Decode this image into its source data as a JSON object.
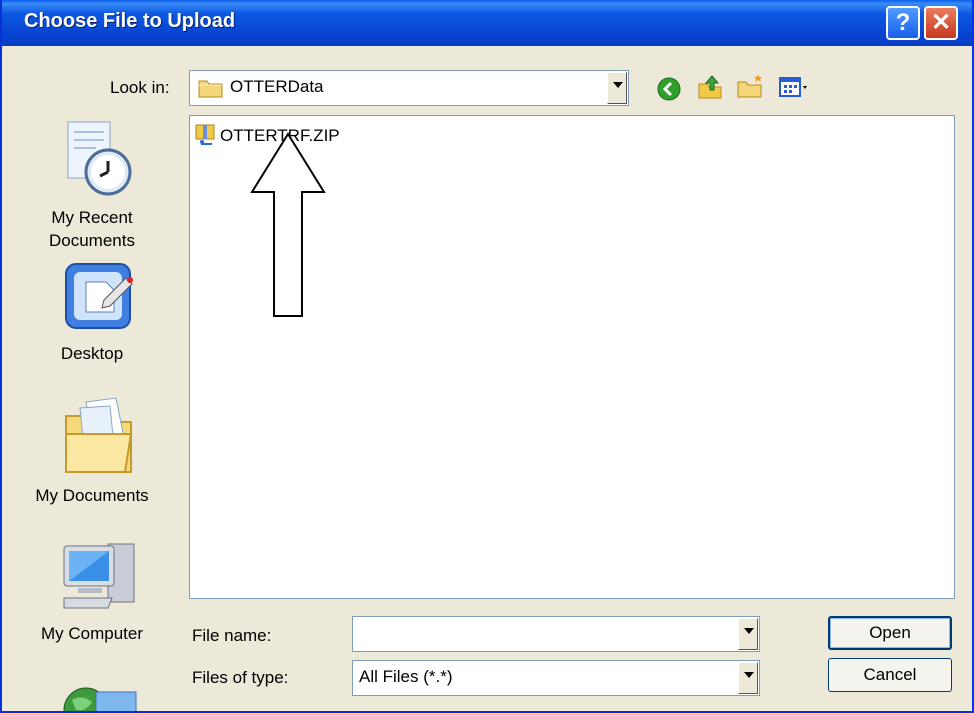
{
  "window": {
    "title": "Choose File to Upload",
    "help_glyph": "?",
    "close_glyph": "✕"
  },
  "toolbar": {
    "look_in_label": "Look in:",
    "look_in_value": "OTTERData",
    "icons": [
      "back-icon",
      "up-folder-icon",
      "new-folder-icon",
      "view-menu-icon"
    ]
  },
  "places": [
    {
      "label_lines": [
        "My Recent",
        "Documents"
      ],
      "icon": "recent-documents-icon"
    },
    {
      "label_lines": [
        "Desktop"
      ],
      "icon": "desktop-icon"
    },
    {
      "label_lines": [
        "My Documents"
      ],
      "icon": "my-documents-icon"
    },
    {
      "label_lines": [
        "My Computer"
      ],
      "icon": "my-computer-icon"
    },
    {
      "label_lines": [],
      "icon": "network-places-icon"
    }
  ],
  "files": [
    {
      "name": "OTTERTRF.ZIP",
      "icon": "zip-file-icon"
    }
  ],
  "annotation": {
    "icon": "up-arrow-annotation-icon"
  },
  "bottom": {
    "file_name_label": "File name:",
    "file_name_value": "",
    "file_type_label": "Files of type:",
    "file_type_value": "All Files (*.*)",
    "open_label": "Open",
    "cancel_label": "Cancel"
  },
  "colors": {
    "titlebar": "#0845d3",
    "dialog_bg": "#ece9d8",
    "border": "#7f9db9"
  }
}
